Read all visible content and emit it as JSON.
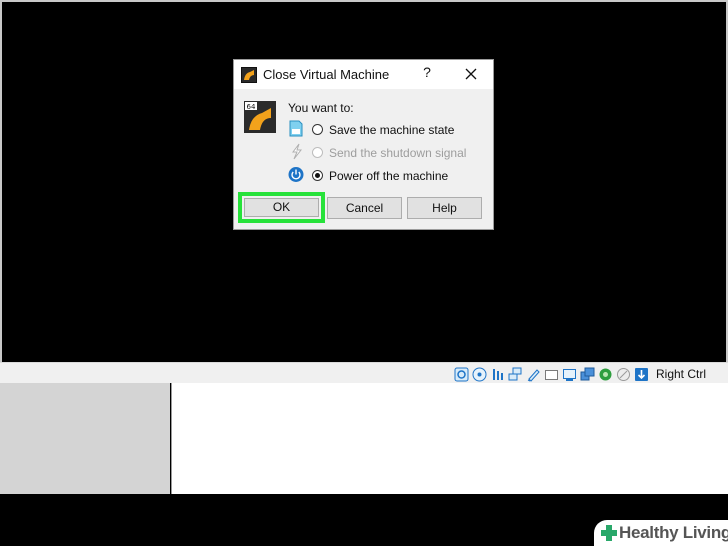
{
  "dialog": {
    "title": "Close Virtual Machine",
    "help_symbol": "?",
    "prompt": "You want to:",
    "options": [
      {
        "label": "Save the machine state",
        "icon": "save-state-icon",
        "enabled": true,
        "checked": false
      },
      {
        "label": "Send the shutdown signal",
        "icon": "shutdown-signal-icon",
        "enabled": false,
        "checked": false
      },
      {
        "label": "Power off the machine",
        "icon": "power-icon",
        "enabled": true,
        "checked": true
      }
    ],
    "buttons": {
      "ok": "OK",
      "cancel": "Cancel",
      "help": "Help"
    }
  },
  "statusbar": {
    "icons": [
      "hard-disk-icon",
      "optical-drive-icon",
      "audio-icon",
      "network-icon",
      "usb-icon",
      "shared-folders-icon",
      "display-icon",
      "video-capture-icon",
      "virtualization-icon",
      "mouse-integration-icon",
      "host-key-icon"
    ],
    "host_key": "Right Ctrl"
  },
  "watermark": {
    "text": "Healthy Living"
  },
  "colors": {
    "highlight": "#27e23a",
    "dialog_bg": "#f0f0f0",
    "button_bg": "#e1e1e1",
    "icon_blue": "#1e74c7"
  }
}
